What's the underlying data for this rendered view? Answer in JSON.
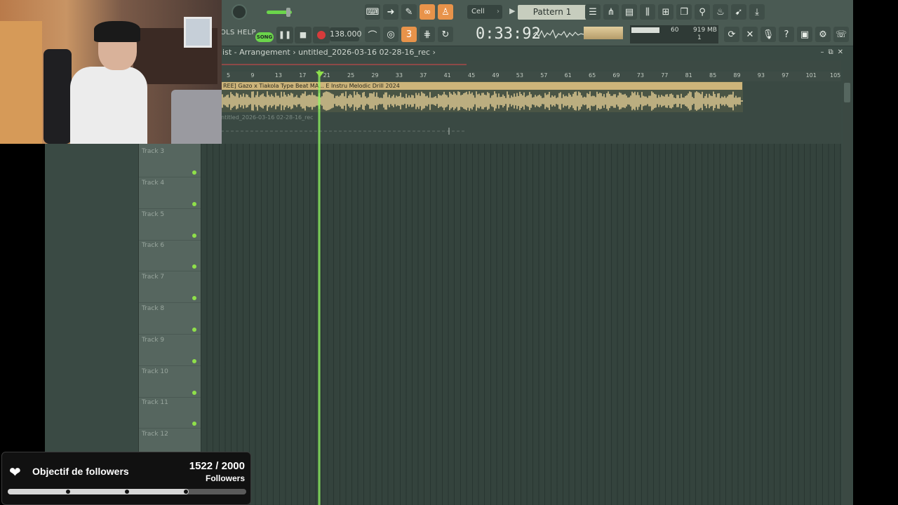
{
  "toolbar": {
    "menu_partial": "OLS HELP",
    "song_label": "SONG",
    "tempo": "138.000",
    "time": "0:33:92",
    "snap": "Cell",
    "pattern": "Pattern 1",
    "cpu": "60",
    "memory": "919 MB",
    "memory_line2": "1"
  },
  "window": {
    "breadcrumb_part1": "list - Arrangement",
    "breadcrumb_sep": "›",
    "breadcrumb_part2": "untitled_2026-03-16 02-28-16_rec"
  },
  "ruler": {
    "ticks": [
      "5",
      "9",
      "13",
      "17",
      "21",
      "25",
      "29",
      "33",
      "37",
      "41",
      "45",
      "49",
      "53",
      "57",
      "61",
      "65",
      "69",
      "73",
      "77",
      "81",
      "85",
      "89",
      "93",
      "97",
      "101",
      "105"
    ]
  },
  "clips": {
    "audio_title": "REE] Gazo x Tiakola Type Beat MA... E  Instru Melodic Drill 2024",
    "rec_title": "ntitled_2026-03-16 02-28-16_rec"
  },
  "tracks": [
    "Track 3",
    "Track 4",
    "Track 5",
    "Track 6",
    "Track 7",
    "Track 8",
    "Track 9",
    "Track 10",
    "Track 11",
    "Track 12"
  ],
  "followers": {
    "title": "Objectif de followers",
    "count": "1522 / 2000",
    "unit": "Followers",
    "progress_percent": 76
  },
  "colors": {
    "accent_green": "#8fe04a",
    "accent_orange": "#e8934a",
    "clip_gold": "#cdb47a"
  }
}
